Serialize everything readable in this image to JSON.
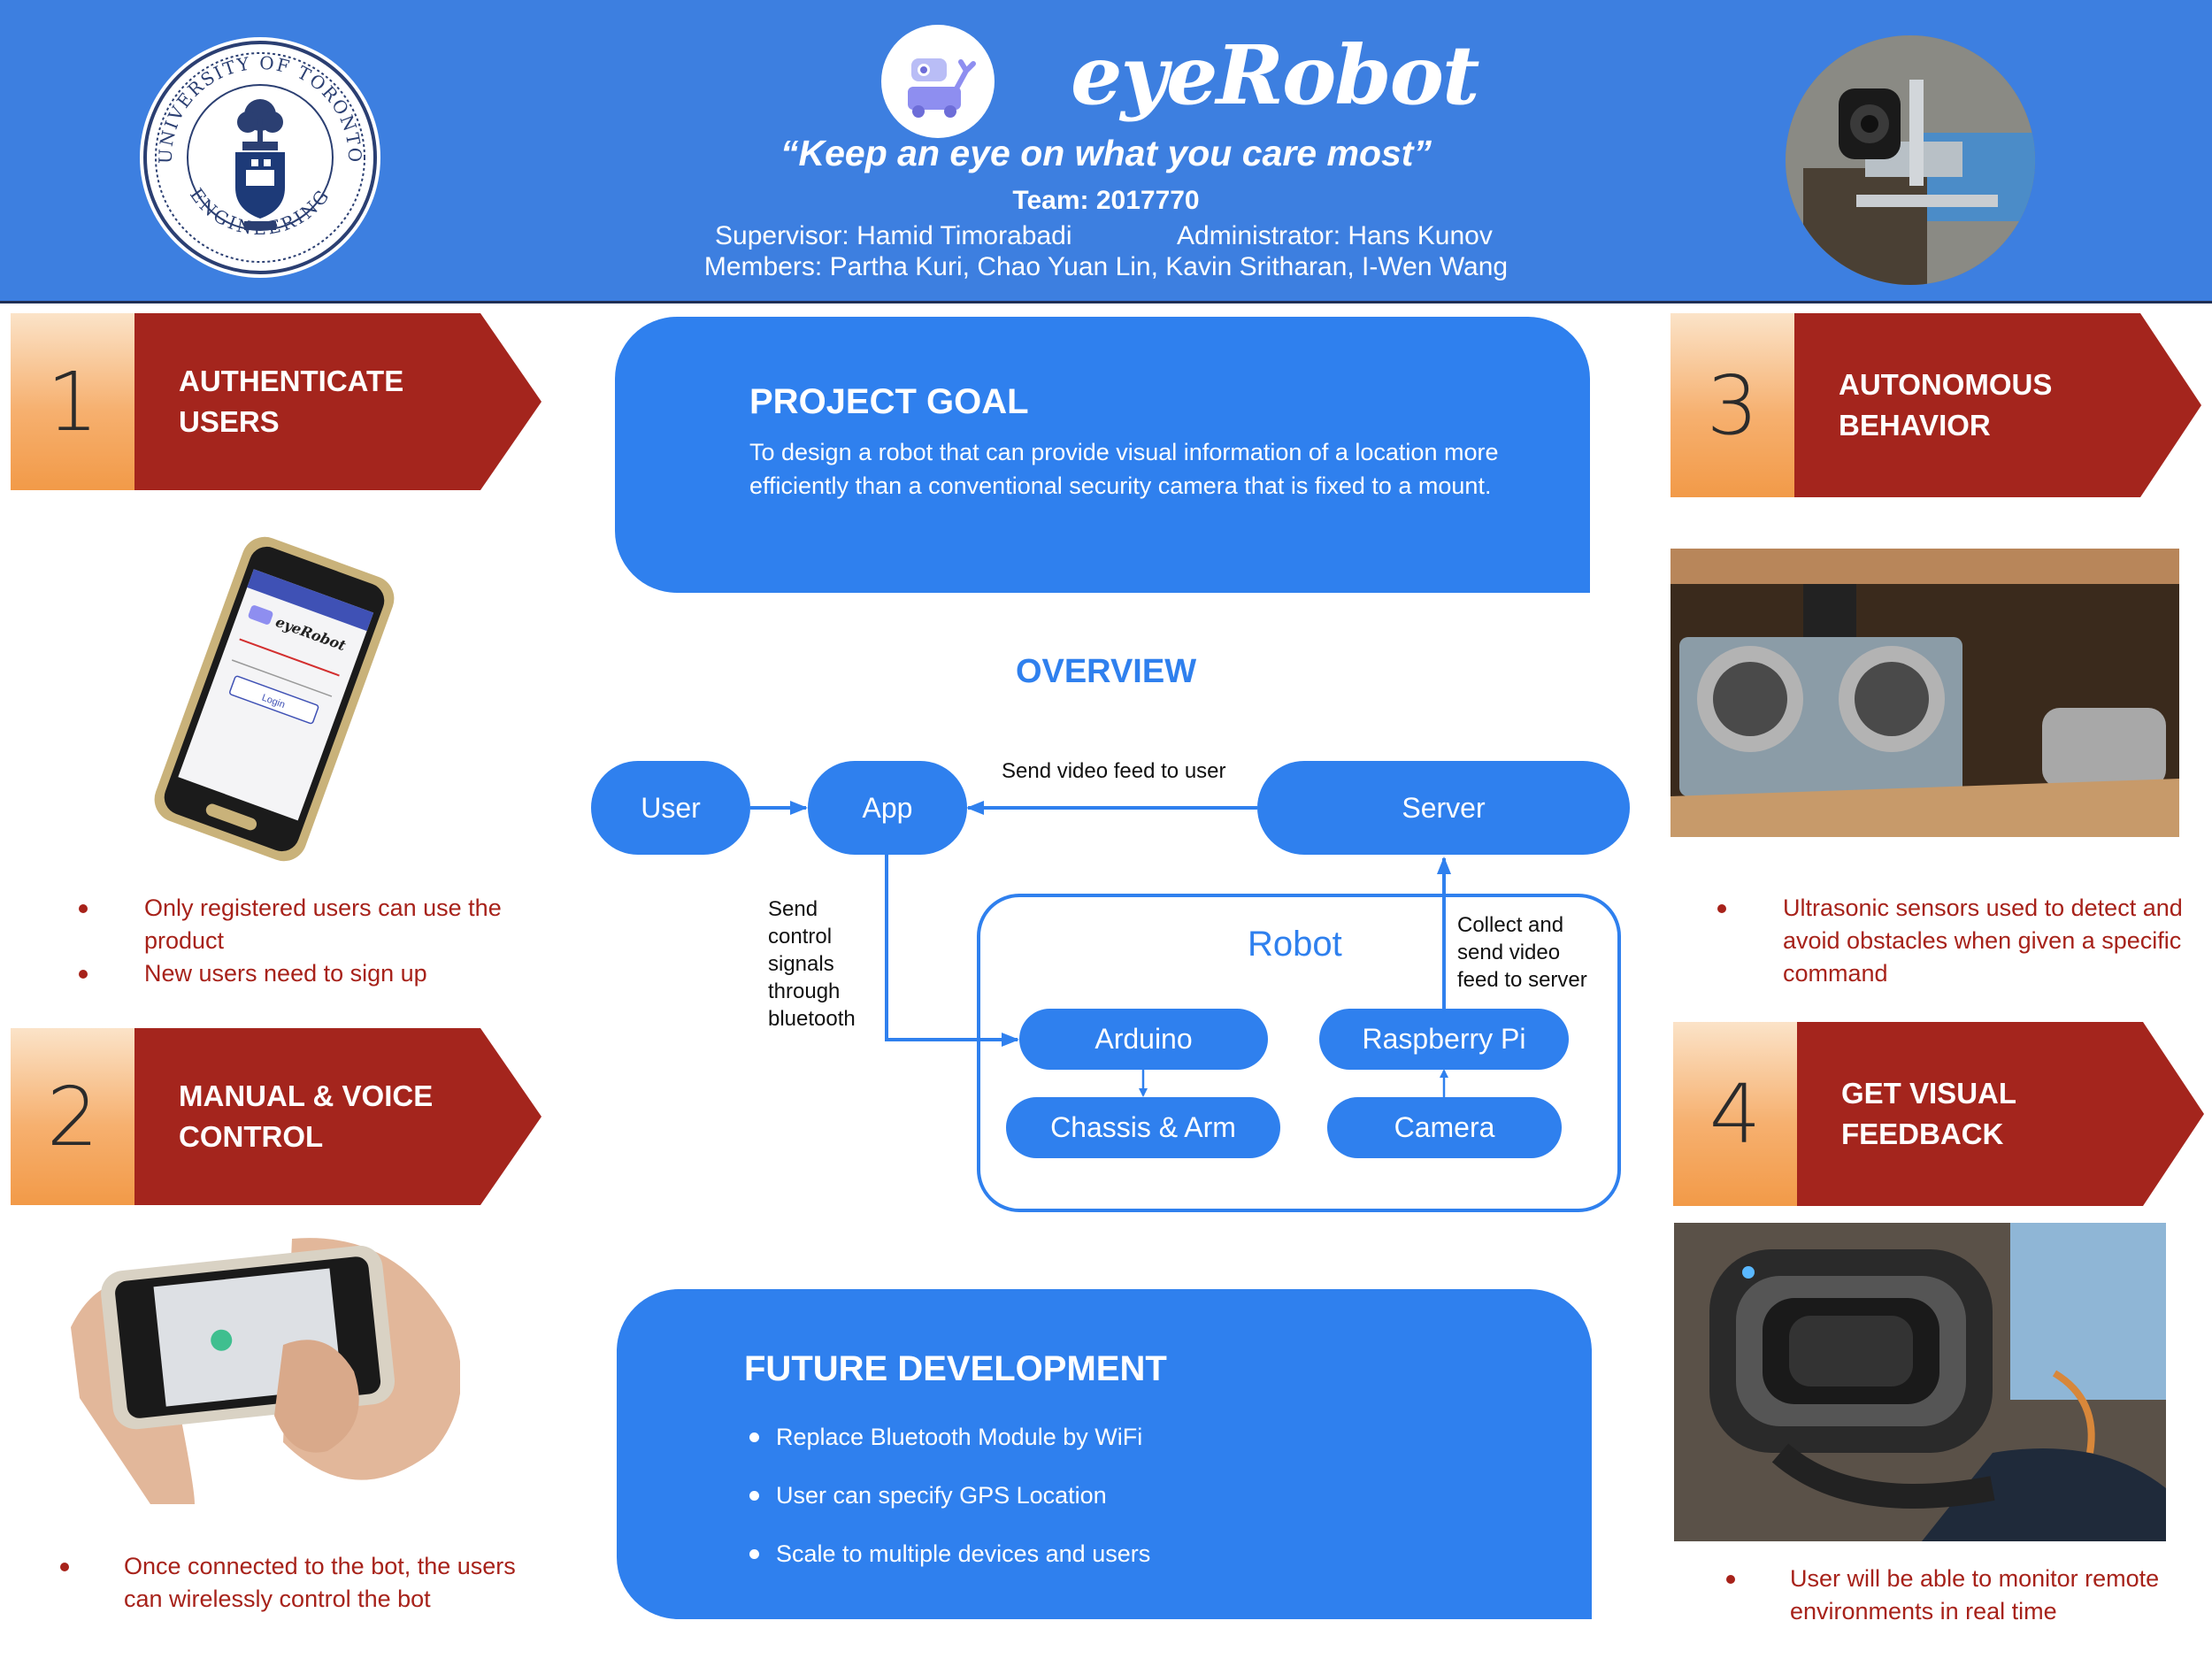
{
  "header": {
    "brand": "eyeRobot",
    "tagline": "“Keep an eye on what you care most”",
    "team": "Team: 2017770",
    "supervisor": "Supervisor: Hamid Timorabadi",
    "administrator": "Administrator: Hans Kunov",
    "members": "Members: Partha Kuri, Chao Yuan Lin, Kavin Sritharan, I-Wen Wang",
    "seal": {
      "top_text": "UNIVERSITY OF TORONTO",
      "bottom_text": "ENGINEERING"
    }
  },
  "features": [
    {
      "number": "1",
      "title": "AUTHENTICATE\nUSERS"
    },
    {
      "number": "2",
      "title": "MANUAL & VOICE\nCONTROL"
    },
    {
      "number": "3",
      "title": "AUTONOMOUS\nBEHAVIOR"
    },
    {
      "number": "4",
      "title": "GET VISUAL\nFEEDBACK"
    }
  ],
  "feature_notes": {
    "authenticate": [
      "Only registered users can use the product",
      "New users need to sign up"
    ],
    "manual": [
      "Once connected to the bot, the users can wirelessly control the bot"
    ],
    "autonomous": [
      "Ultrasonic sensors used to detect and avoid obstacles when given a specific command"
    ],
    "visual": [
      "User will be able to monitor remote environments in real time"
    ]
  },
  "phone_screen": {
    "app_name": "eyeRobot",
    "login_button": "Login"
  },
  "project_goal": {
    "title": "PROJECT GOAL",
    "text": "To design a robot that can provide visual information of a location more efficiently than a conventional security camera that is fixed to a mount."
  },
  "overview": {
    "title": "OVERVIEW",
    "nodes": {
      "user": "User",
      "app": "App",
      "server": "Server",
      "robot": "Robot",
      "arduino": "Arduino",
      "raspberry": "Raspberry Pi",
      "chassis": "Chassis & Arm",
      "camera": "Camera"
    },
    "edges": {
      "server_to_app": "Send video feed to user",
      "app_to_arduino": "Send\ncontrol\nsignals\nthrough\nbluetooth",
      "pi_to_server": "Collect and\nsend video\nfeed to server"
    }
  },
  "future_development": {
    "title": "FUTURE DEVELOPMENT",
    "items": [
      "Replace Bluetooth Module by WiFi",
      "User can specify GPS Location",
      "Scale to multiple devices and users"
    ]
  },
  "colors": {
    "header_blue": "#3d7fe0",
    "panel_blue": "#2f80ee",
    "banner_red": "#a4251d",
    "note_red": "#a7221a",
    "number_orange": "#f6b06f"
  }
}
